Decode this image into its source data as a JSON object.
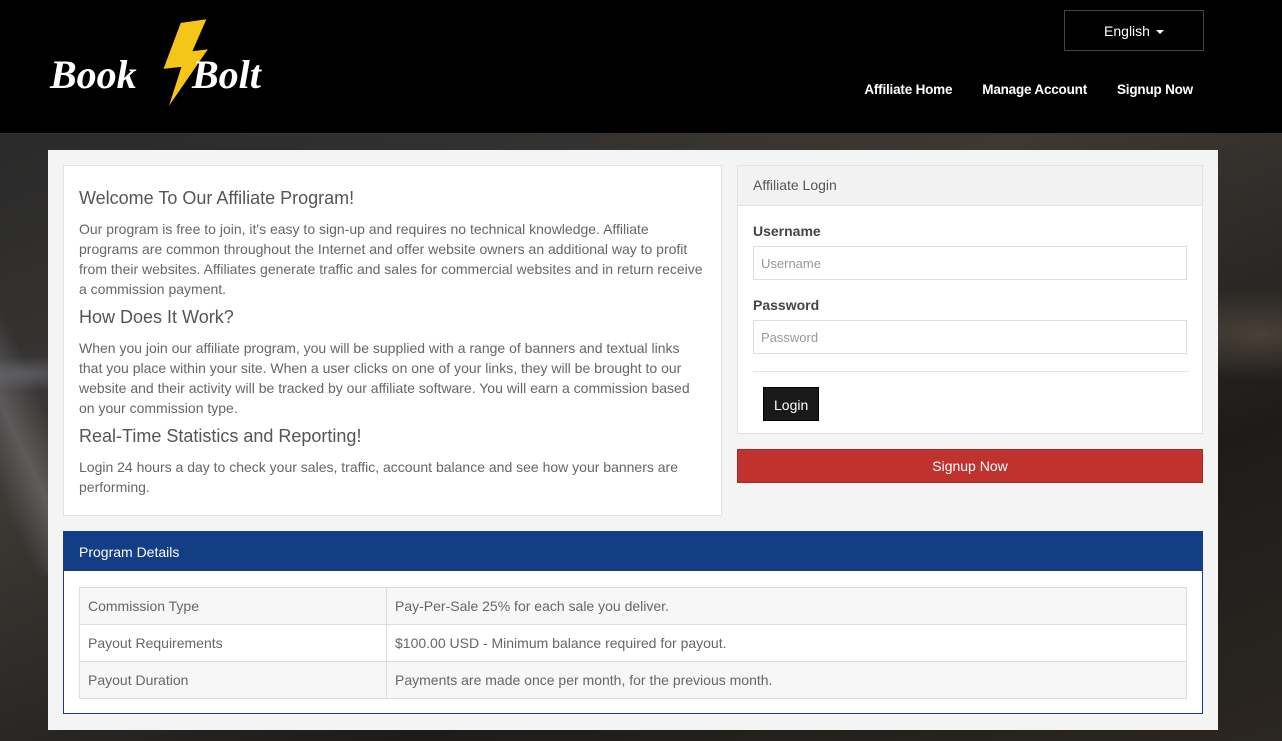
{
  "brand": {
    "logo_text_left": "Book",
    "logo_text_right": "Bolt",
    "bolt_color": "#f5c518"
  },
  "header": {
    "language": "English",
    "nav": [
      "Affiliate Home",
      "Manage Account",
      "Signup Now"
    ]
  },
  "welcome": {
    "heading1": "Welcome To Our Affiliate Program!",
    "para1": "Our program is free to join, it's easy to sign-up and requires no technical knowledge. Affiliate programs are common throughout the Internet and offer website owners an additional way to profit from their websites. Affiliates generate traffic and sales for commercial websites and in return receive a commission payment.",
    "heading2": "How Does It Work?",
    "para2": "When you join our affiliate program, you will be supplied with a range of banners and textual links that you place within your site. When a user clicks on one of your links, they will be brought to our website and their activity will be tracked by our affiliate software. You will earn a commission based on your commission type.",
    "heading3": "Real-Time Statistics and Reporting!",
    "para3": "Login 24 hours a day to check your sales, traffic, account balance and see how your banners are performing."
  },
  "login": {
    "title": "Affiliate Login",
    "username_label": "Username",
    "username_placeholder": "Username",
    "password_label": "Password",
    "password_placeholder": "Password",
    "login_button": "Login"
  },
  "signup_button": "Signup Now",
  "program": {
    "title": "Program Details",
    "rows": [
      [
        "Commission Type",
        "Pay-Per-Sale 25% for each sale you deliver."
      ],
      [
        "Payout Requirements",
        "$100.00 USD - Minimum balance required for payout."
      ],
      [
        "Payout Duration",
        "Payments are made once per month, for the previous month."
      ]
    ]
  },
  "colors": {
    "header_bg": "#000000",
    "signup_red": "#c0322e",
    "program_blue": "#133d85"
  }
}
